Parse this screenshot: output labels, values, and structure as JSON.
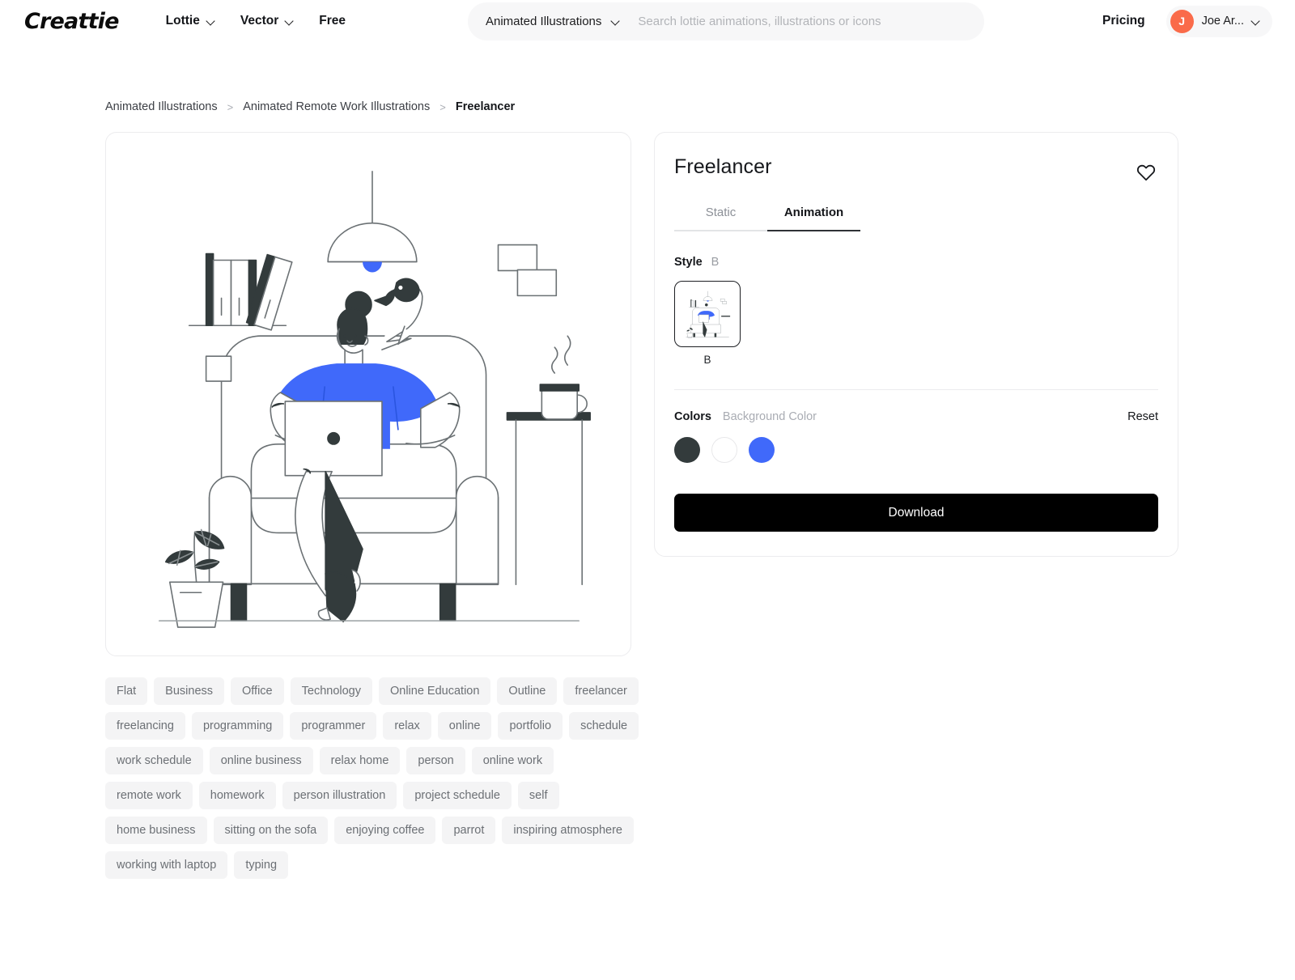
{
  "header": {
    "logo": "Creattie",
    "nav": [
      {
        "label": "Lottie",
        "has_dropdown": true
      },
      {
        "label": "Vector",
        "has_dropdown": true
      },
      {
        "label": "Free",
        "has_dropdown": false
      }
    ],
    "search": {
      "category": "Animated Illustrations",
      "placeholder": "Search lottie animations, illustrations or icons",
      "value": ""
    },
    "pricing_label": "Pricing",
    "user": {
      "initial": "J",
      "name": "Joe Ar..."
    }
  },
  "breadcrumb": {
    "items": [
      "Animated Illustrations",
      "Animated Remote Work Illustrations",
      "Freelancer"
    ],
    "separator": ">"
  },
  "detail": {
    "title": "Freelancer",
    "favorite_icon": "heart-icon",
    "tabs": [
      {
        "label": "Static",
        "active": false
      },
      {
        "label": "Animation",
        "active": true
      }
    ],
    "style": {
      "label": "Style",
      "selected": "B",
      "options": [
        {
          "caption": "B",
          "selected": true
        }
      ]
    },
    "colors": {
      "label": "Colors",
      "sublabel": "Background Color",
      "reset_label": "Reset",
      "swatches": [
        "#333b3c",
        "#ffffff",
        "#4069fa"
      ]
    },
    "download_label": "Download"
  },
  "illustration": {
    "accent_color": "#4069fa",
    "ink_color": "#333b3c",
    "line_color": "#6b7174",
    "alt": "Freelancer sitting on sofa working with laptop, parrot on sofa back, plant, coffee cup, pendant lamp, bookshelf"
  },
  "tags": [
    "Flat",
    "Business",
    "Office",
    "Technology",
    "Online Education",
    "Outline",
    "freelancer",
    "freelancing",
    "programming",
    "programmer",
    "relax",
    "online",
    "portfolio",
    "schedule",
    "work schedule",
    "online business",
    "relax home",
    "person",
    "online work",
    "remote work",
    "homework",
    "person illustration",
    "project schedule",
    "self",
    "home business",
    "sitting on the sofa",
    "enjoying coffee",
    "parrot",
    "inspiring atmosphere",
    "working with laptop",
    "typing"
  ]
}
